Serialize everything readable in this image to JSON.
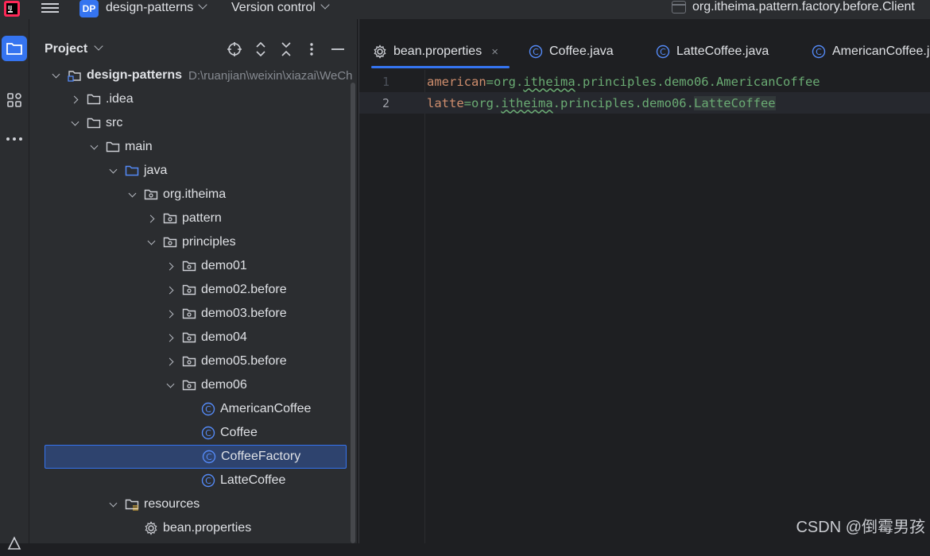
{
  "titlebar": {
    "project_badge": "DP",
    "project_name": "design-patterns",
    "vcs_label": "Version control",
    "run_config": "org.itheima.pattern.factory.before.Client"
  },
  "stripe": {
    "icons": [
      "folder-icon",
      "structure-icon",
      "more-icon"
    ]
  },
  "panel": {
    "title": "Project"
  },
  "tree": [
    {
      "label": "design-patterns",
      "path": "D:\\ruanjian\\weixin\\xiazai\\WeCh",
      "icon": "module-icon",
      "expanded": true
    },
    {
      "label": ".idea",
      "icon": "folder-icon",
      "expanded": false
    },
    {
      "label": "src",
      "icon": "folder-icon",
      "expanded": true
    },
    {
      "label": "main",
      "icon": "folder-icon",
      "expanded": true
    },
    {
      "label": "java",
      "icon": "source-folder-icon",
      "expanded": true
    },
    {
      "label": "org.itheima",
      "icon": "package-icon",
      "expanded": true
    },
    {
      "label": "pattern",
      "icon": "package-icon",
      "expanded": false
    },
    {
      "label": "principles",
      "icon": "package-icon",
      "expanded": true
    },
    {
      "label": "demo01",
      "icon": "package-icon",
      "expanded": false
    },
    {
      "label": "demo02.before",
      "icon": "package-icon",
      "expanded": false
    },
    {
      "label": "demo03.before",
      "icon": "package-icon",
      "expanded": false
    },
    {
      "label": "demo04",
      "icon": "package-icon",
      "expanded": false
    },
    {
      "label": "demo05.before",
      "icon": "package-icon",
      "expanded": false
    },
    {
      "label": "demo06",
      "icon": "package-icon",
      "expanded": true
    },
    {
      "label": "AmericanCoffee",
      "icon": "class-icon"
    },
    {
      "label": "Coffee",
      "icon": "class-icon"
    },
    {
      "label": "CoffeeFactory",
      "icon": "class-icon",
      "selected": true
    },
    {
      "label": "LatteCoffee",
      "icon": "class-icon"
    },
    {
      "label": "resources",
      "icon": "resources-folder-icon",
      "expanded": true
    },
    {
      "label": "bean.properties",
      "icon": "properties-icon"
    }
  ],
  "tabs": [
    {
      "label": "bean.properties",
      "icon": "gear-icon",
      "active": true,
      "close": "×"
    },
    {
      "label": "Coffee.java",
      "icon": "class-icon"
    },
    {
      "label": "LatteCoffee.java",
      "icon": "class-icon"
    },
    {
      "label": "AmericanCoffee.java",
      "icon": "class-icon"
    }
  ],
  "code": {
    "line_numbers": [
      "1",
      "2"
    ],
    "line1": {
      "key": "american",
      "eq": "=",
      "v1": "org.",
      "v2": "itheima",
      "v3": ".principles.demo06.AmericanCoffee"
    },
    "line2": {
      "key": "latte",
      "eq": "=",
      "v1": "org.",
      "v2": "itheima",
      "v3": ".principles.demo06.",
      "v4": "LatteCoffee"
    }
  },
  "watermark": "CSDN @倒霉男孩",
  "colors": {
    "accent": "#3574f0",
    "key": "#cf8e6d",
    "value": "#6aab73",
    "background": "#1e1f22",
    "panel": "#2b2d30"
  }
}
